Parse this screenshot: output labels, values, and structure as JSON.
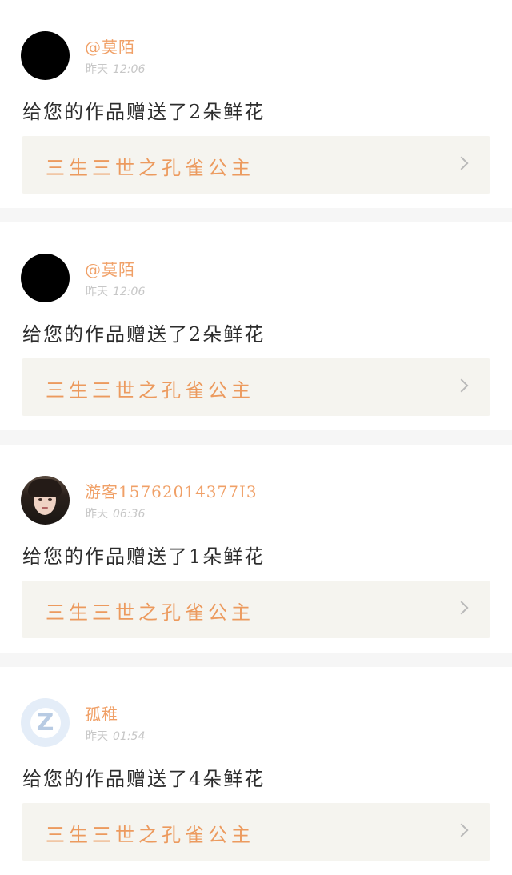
{
  "notifications": [
    {
      "avatar": "black-circle",
      "username": "@莫陌",
      "day": "昨天",
      "time": "12:06",
      "message": "给您的作品赠送了2朵鲜花",
      "work_title": "三生三世之孔雀公主"
    },
    {
      "avatar": "black-circle",
      "username": "@莫陌",
      "day": "昨天",
      "time": "12:06",
      "message": "给您的作品赠送了2朵鲜花",
      "work_title": "三生三世之孔雀公主"
    },
    {
      "avatar": "portrait-photo",
      "username": "游客15762014377I3",
      "day": "昨天",
      "time": "06:36",
      "message": "给您的作品赠送了1朵鲜花",
      "work_title": "三生三世之孔雀公主"
    },
    {
      "avatar": "qq-default",
      "username": "孤稚",
      "day": "昨天",
      "time": "01:54",
      "message": "给您的作品赠送了4朵鲜花",
      "work_title": "三生三世之孔雀公主"
    }
  ],
  "colors": {
    "accent_tab": "#e77aa9",
    "username": "#f0a067",
    "work_title": "#ec9a5e",
    "message": "#2d2d2d",
    "time": "#c7c7c7",
    "work_box_bg": "#f5f4ef",
    "separator": "#f6f6f6"
  },
  "icons": {
    "chevron": "chevron-right-icon",
    "qq_avatar": "qq-z-icon"
  }
}
